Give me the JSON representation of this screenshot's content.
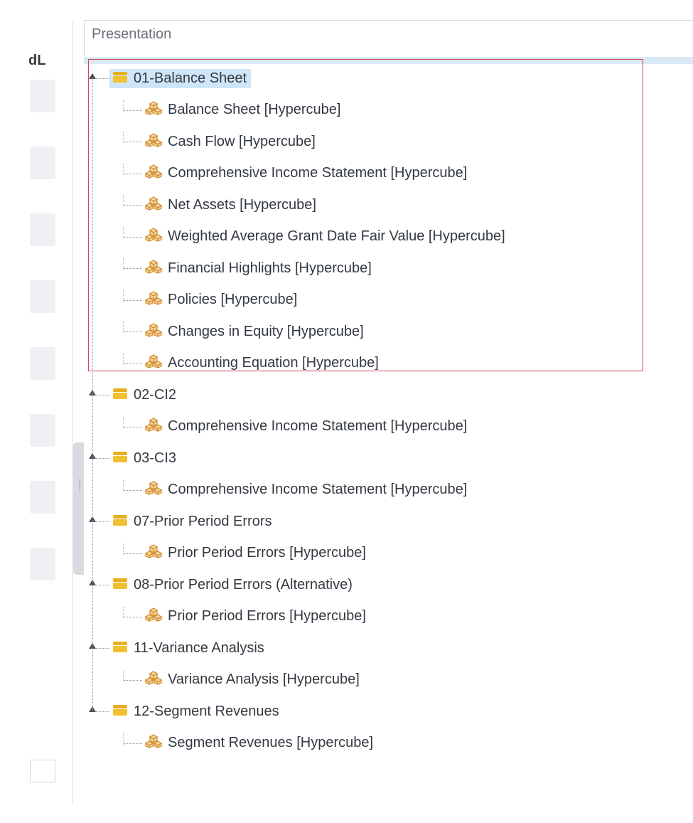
{
  "panel": {
    "header_label": "Presentation",
    "left_column_label": "dL"
  },
  "colors": {
    "selection": "#cfe6f8",
    "highlight_border": "#d6424e",
    "folder_icon": "#e8b020",
    "cube_icon": "#e0a23a"
  },
  "tree": {
    "groups": [
      {
        "label": "01-Balance Sheet",
        "selected": true,
        "children": [
          "Balance Sheet [Hypercube]",
          "Cash Flow [Hypercube]",
          "Comprehensive Income Statement [Hypercube]",
          "Net Assets [Hypercube]",
          "Weighted Average Grant Date Fair Value [Hypercube]",
          "Financial Highlights [Hypercube]",
          "Policies [Hypercube]",
          "Changes in Equity [Hypercube]",
          "Accounting Equation [Hypercube]"
        ]
      },
      {
        "label": "02-CI2",
        "children": [
          "Comprehensive Income Statement [Hypercube]"
        ]
      },
      {
        "label": "03-CI3",
        "children": [
          "Comprehensive Income Statement [Hypercube]"
        ]
      },
      {
        "label": "07-Prior Period Errors",
        "children": [
          "Prior Period Errors [Hypercube]"
        ]
      },
      {
        "label": "08-Prior Period Errors (Alternative)",
        "children": [
          "Prior Period Errors [Hypercube]"
        ]
      },
      {
        "label": "11-Variance Analysis",
        "children": [
          "Variance Analysis [Hypercube]"
        ]
      },
      {
        "label": "12-Segment Revenues",
        "children": [
          "Segment Revenues [Hypercube]"
        ]
      }
    ]
  }
}
